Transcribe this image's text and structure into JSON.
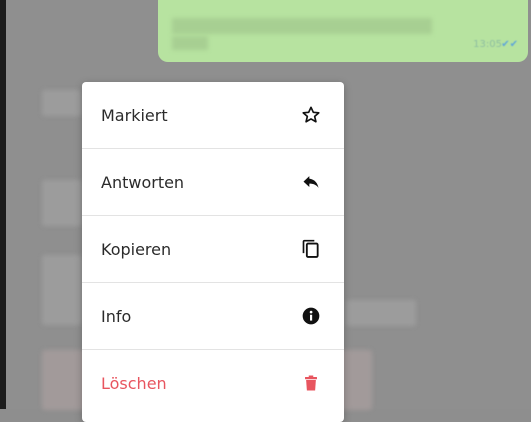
{
  "message": {
    "time": "13:05",
    "status_icon": "double-check-icon",
    "status_color": "#5fa6d8"
  },
  "context_menu": {
    "items": [
      {
        "label": "Markiert",
        "icon": "star-outline-icon"
      },
      {
        "label": "Antworten",
        "icon": "reply-icon"
      },
      {
        "label": "Kopieren",
        "icon": "copy-icon"
      },
      {
        "label": "Info",
        "icon": "info-circle-icon"
      },
      {
        "label": "Löschen",
        "icon": "trash-icon",
        "color": "#e8555f"
      }
    ]
  }
}
